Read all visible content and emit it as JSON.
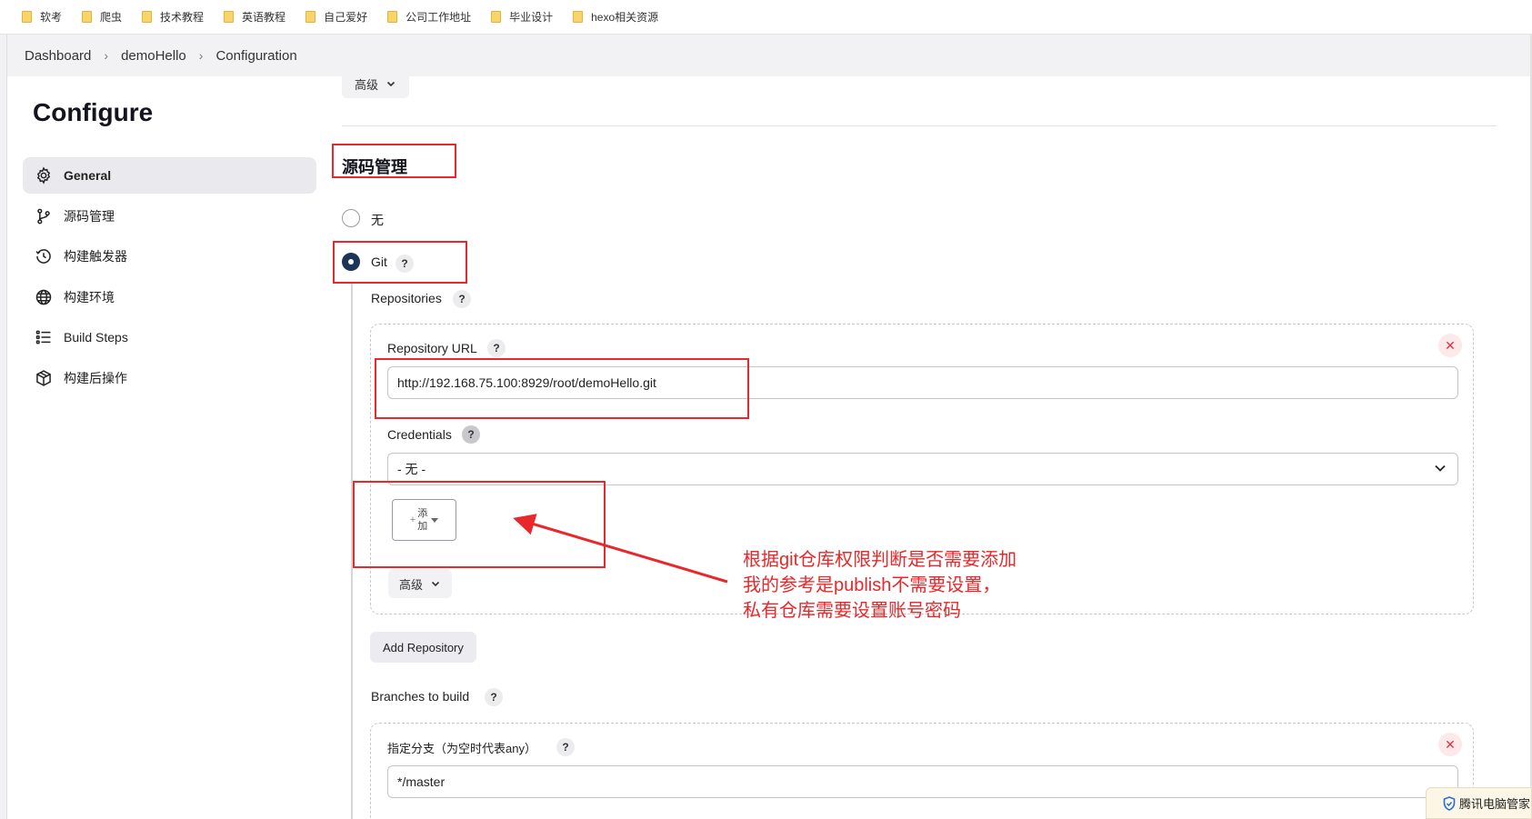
{
  "bookmarks": [
    "软考",
    "爬虫",
    "技术教程",
    "英语教程",
    "自己爱好",
    "公司工作地址",
    "毕业设计",
    "hexo相关资源"
  ],
  "breadcrumb": [
    "Dashboard",
    "demoHello",
    "Configuration"
  ],
  "page_title": "Configure",
  "sidebar": {
    "items": [
      {
        "label": "General",
        "icon": "gear-icon",
        "active": true
      },
      {
        "label": "源码管理",
        "icon": "branch-icon",
        "active": false
      },
      {
        "label": "构建触发器",
        "icon": "clock-icon",
        "active": false
      },
      {
        "label": "构建环境",
        "icon": "globe-icon",
        "active": false
      },
      {
        "label": "Build Steps",
        "icon": "list-icon",
        "active": false
      },
      {
        "label": "构建后操作",
        "icon": "package-icon",
        "active": false
      }
    ]
  },
  "main": {
    "advanced_label": "高级",
    "section_title": "源码管理",
    "scm_options": [
      {
        "label": "无",
        "checked": false
      },
      {
        "label": "Git",
        "checked": true
      }
    ],
    "help_mark": "?",
    "repositories_label": "Repositories",
    "repository_url_label": "Repository URL",
    "repository_url_value": "http://192.168.75.100:8929/root/demoHello.git",
    "credentials_label": "Credentials",
    "credentials_value": "- 无 -",
    "add_button": {
      "plus": "+",
      "line1": "添",
      "line2": "加"
    },
    "repo_advanced_label": "高级",
    "add_repository_label": "Add Repository",
    "branches_label": "Branches to build",
    "branch_specifier_label": "指定分支（为空时代表any）",
    "branch_specifier_value": "*/master",
    "close_symbol": "✕"
  },
  "annotation": {
    "lines": [
      "根据git仓库权限判断是否需要添加",
      "我的参考是publish不需要设置，",
      "私有仓库需要设置账号密码"
    ],
    "color": "#e8282a"
  },
  "tray": {
    "label": "腾讯电脑管家"
  },
  "colors": {
    "radio_checked": "#1a3556",
    "annotation_red": "#e8282a",
    "close_red": "#d9313f"
  }
}
